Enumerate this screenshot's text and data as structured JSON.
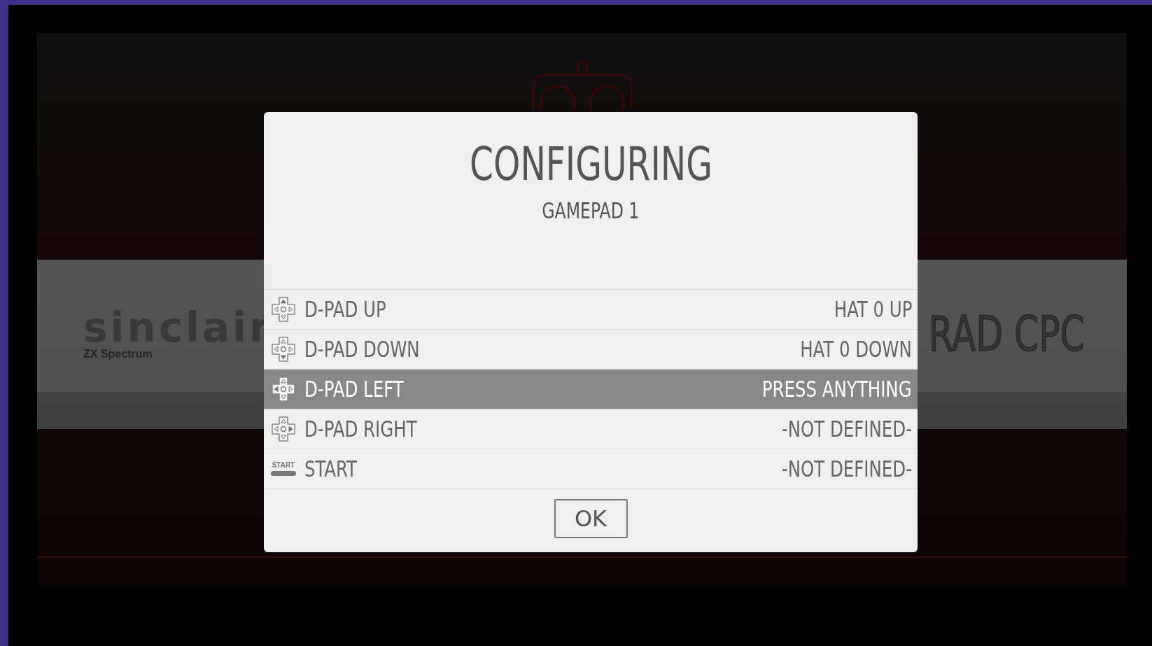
{
  "background": {
    "left_system": {
      "logo": "sinclair",
      "model": "ZX Spectrum"
    },
    "right_system": {
      "logo": "RAD CPC"
    }
  },
  "dialog": {
    "title": "CONFIGURING",
    "subtitle": "GAMEPAD 1",
    "rows": [
      {
        "kind": "up",
        "label": "D-PAD UP",
        "value": "HAT 0 UP",
        "selected": false
      },
      {
        "kind": "down",
        "label": "D-PAD DOWN",
        "value": "HAT 0 DOWN",
        "selected": false
      },
      {
        "kind": "left",
        "label": "D-PAD LEFT",
        "value": "PRESS ANYTHING",
        "selected": true
      },
      {
        "kind": "right",
        "label": "D-PAD RIGHT",
        "value": "-NOT DEFINED-",
        "selected": false
      },
      {
        "kind": "start",
        "icon_text": "START",
        "label": "START",
        "value": "-NOT DEFINED-",
        "selected": false
      }
    ],
    "button": "OK"
  }
}
